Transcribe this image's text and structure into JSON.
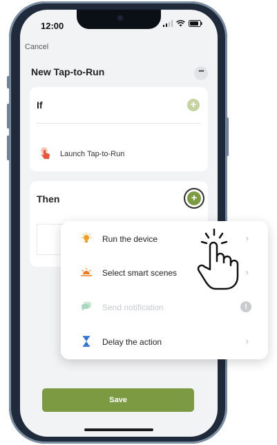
{
  "status_bar": {
    "time": "12:00"
  },
  "header": {
    "cancel_label": "Cancel",
    "title": "New Tap-to-Run",
    "more_icon": "more-dots-icon"
  },
  "if_card": {
    "title": "If",
    "condition_label": "Launch Tap-to-Run",
    "condition_icon": "finger-tap-icon"
  },
  "then_card": {
    "title": "Then"
  },
  "popup_menu": {
    "items": [
      {
        "label": "Run the device",
        "icon": "lightbulb-icon",
        "enabled": true
      },
      {
        "label": "Select smart scenes",
        "icon": "sunrise-icon",
        "enabled": true
      },
      {
        "label": "Send notification",
        "icon": "chat-bubbles-icon",
        "enabled": false
      },
      {
        "label": "Delay the action",
        "icon": "hourglass-icon",
        "enabled": true
      }
    ]
  },
  "save_label": "Save",
  "colors": {
    "accent": "#7c9a42",
    "accent_light": "#c5d3a0",
    "icon_orange": "#f0a020",
    "icon_blue": "#2f6fd0"
  }
}
